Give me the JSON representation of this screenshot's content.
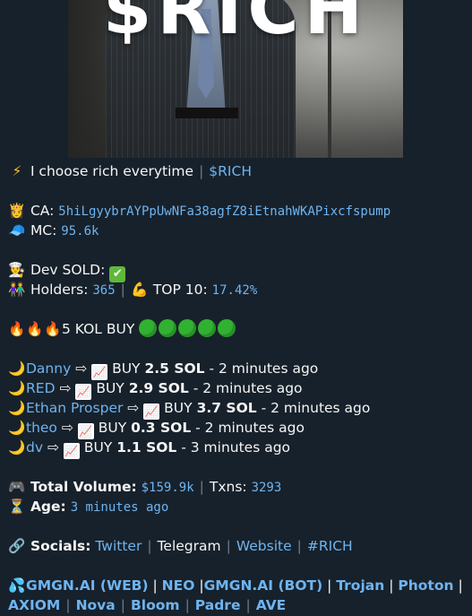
{
  "banner": {
    "title": "$RICH"
  },
  "headline": {
    "text": "I choose rich everytime",
    "ticker": "$RICH"
  },
  "token": {
    "ca_label": "CA:",
    "ca_value": "5hiLgyybrAYPpUwNFa38agfZ8iEtnahWKAPixcfspump",
    "mc_label": "MC:",
    "mc_value": "95.6k"
  },
  "dev": {
    "label": "Dev SOLD:",
    "status": "✔"
  },
  "holders": {
    "label": "Holders:",
    "value": "365",
    "top_label": "TOP 10:",
    "top_value": "17.42%"
  },
  "kol": {
    "label": "5 KOL BUY",
    "dot_count": 5,
    "dot_color": "#31b131"
  },
  "buys": [
    {
      "name": "Danny",
      "action": "BUY",
      "amount": "2.5 SOL",
      "time": "- 2 minutes ago"
    },
    {
      "name": "RED",
      "action": "BUY",
      "amount": "2.9 SOL",
      "time": "- 2 minutes ago"
    },
    {
      "name": "Ethan Prosper",
      "action": "BUY",
      "amount": "3.7 SOL",
      "time": "- 2 minutes ago"
    },
    {
      "name": "theo",
      "action": "BUY",
      "amount": "0.3 SOL",
      "time": "- 2 minutes ago"
    },
    {
      "name": "dv",
      "action": "BUY",
      "amount": "1.1 SOL",
      "time": "- 3 minutes ago"
    }
  ],
  "stats": {
    "volume_label": "Total Volume:",
    "volume_value": "$159.9k",
    "txns_label": "Txns:",
    "txns_value": "3293",
    "age_label": "Age:",
    "age_value": "3 minutes ago"
  },
  "socials": {
    "label": "Socials:",
    "twitter": "Twitter",
    "telegram": "Telegram",
    "website": "Website",
    "tag": "#RICH"
  },
  "platforms": {
    "gmgn_web": "GMGN.AI (WEB)",
    "neo": "NEO",
    "gmgn_bot": "GMGN.AI (BOT)",
    "trojan": "Trojan",
    "photon": "Photon",
    "axiom": "AXIOM",
    "nova": "Nova",
    "bloom": "Bloom",
    "padre": "Padre",
    "ave": "AVE"
  },
  "colors": {
    "background": "#17212b",
    "link": "#6eb4f0",
    "text": "#f5f5f5"
  }
}
